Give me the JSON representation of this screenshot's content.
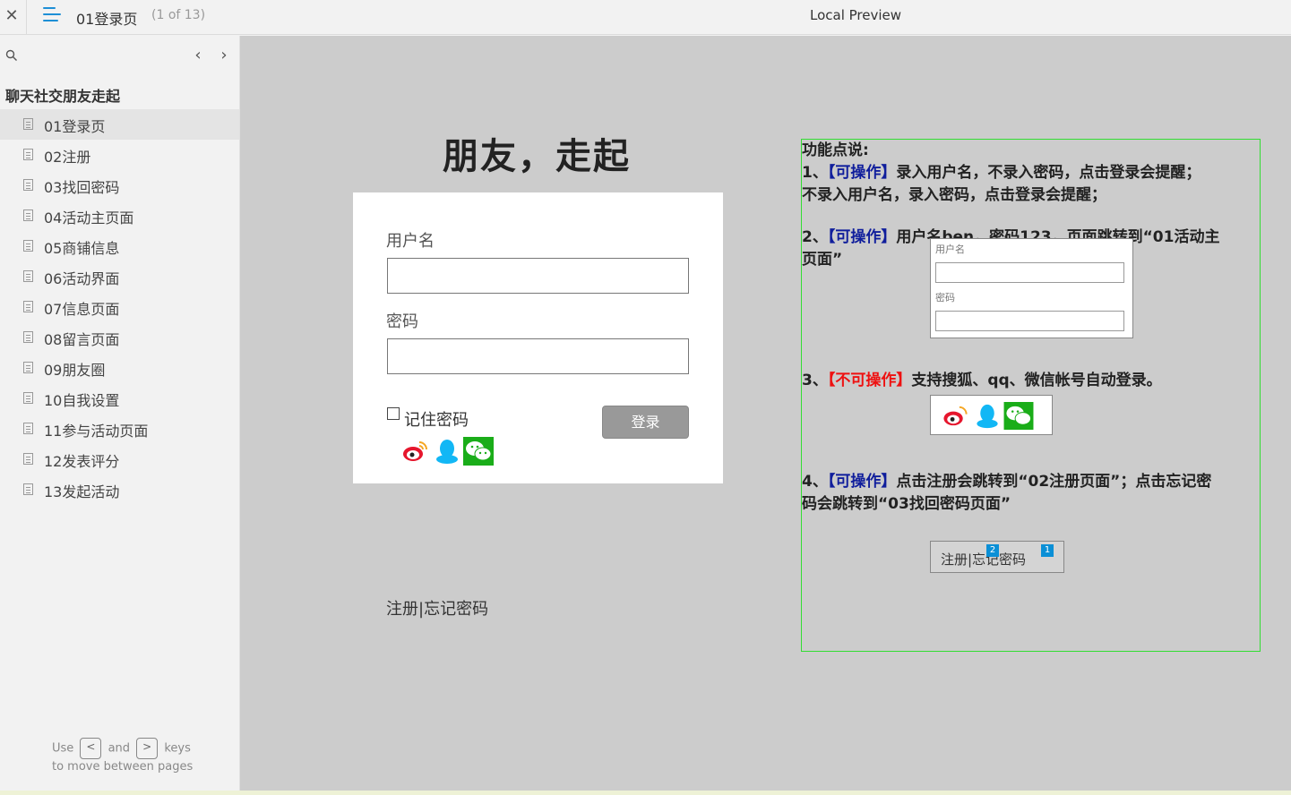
{
  "topbar": {
    "close_glyph": "✕",
    "page_title": "01登录页",
    "page_count": "(1 of 13)",
    "preview_title": "Local Preview"
  },
  "sidebar": {
    "prev_glyph": "‹",
    "next_glyph": "›",
    "project_title": "聊天社交朋友走起",
    "pages": [
      {
        "label": "01登录页",
        "active": true
      },
      {
        "label": "02注册",
        "active": false
      },
      {
        "label": "03找回密码",
        "active": false
      },
      {
        "label": "04活动主页面",
        "active": false
      },
      {
        "label": "05商铺信息",
        "active": false
      },
      {
        "label": "06活动界面",
        "active": false
      },
      {
        "label": "07信息页面",
        "active": false
      },
      {
        "label": "08留言页面",
        "active": false
      },
      {
        "label": "09朋友圈",
        "active": false
      },
      {
        "label": "10自我设置",
        "active": false
      },
      {
        "label": "11参与活动页面",
        "active": false
      },
      {
        "label": "12发表评分",
        "active": false
      },
      {
        "label": "13发起活动",
        "active": false
      }
    ],
    "hint": {
      "use": "Use",
      "key_prev": "<",
      "and": "and",
      "key_next": ">",
      "keys": "keys",
      "line2": "to move between pages"
    }
  },
  "canvas": {
    "hero_title": "朋友，走起",
    "login": {
      "username_label": "用户名",
      "password_label": "密码",
      "remember_label": "记住密码",
      "login_button": "登录"
    },
    "register_link": "注册|忘记密码"
  },
  "annotation": {
    "heading": "功能点说:",
    "item1_num": "1、",
    "item1_tag": "【可操作】",
    "item1_text_a": "录入用户名，不录入密码，点击登录会提醒；",
    "item1_text_b": "不录入用户名，录入密码，点击登录会提醒；",
    "item2_num": "2、",
    "item2_tag": "【可操作】",
    "item2_text_a": "用户名ben，密码123，页面跳转到“01活动主",
    "item2_text_b": "页面”",
    "mini_user_label": "用户名",
    "mini_pass_label": "密码",
    "item3_num": "3、",
    "item3_tag": "【不可操作】",
    "item3_text": "支持搜狐、qq、微信帐号自动登录。",
    "item4_num": "4、",
    "item4_tag": "【可操作】",
    "item4_text_a": "点击注册会跳转到“02注册页面”；点击忘记密",
    "item4_text_b": "码会跳转到“03找回密码页面”",
    "mini_reg_text": "注册|忘记密码",
    "badge_1": "1",
    "badge_2": "2"
  },
  "colors": {
    "accent": "#1e8fd6",
    "tag_blue": "#101e9c",
    "tag_red": "#ee1111",
    "annotation_border": "#33dd33",
    "canvas_bg": "#cccccc"
  }
}
